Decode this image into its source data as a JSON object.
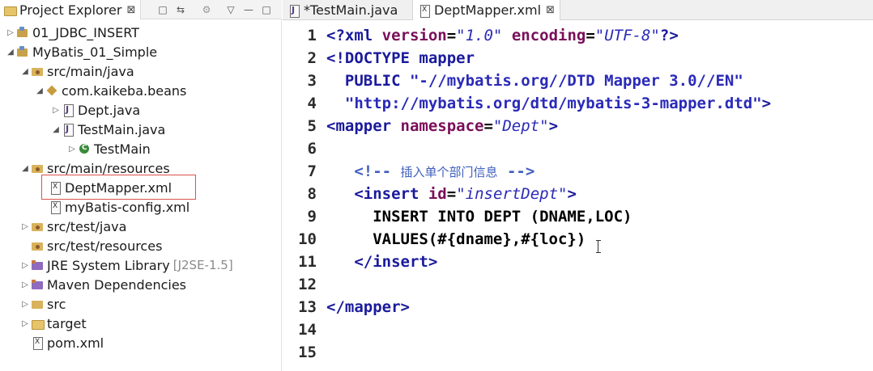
{
  "explorer": {
    "title": "Project Explorer",
    "close": "⊠",
    "toolbar": {
      "collapse_icon": "□",
      "link_icon": "⇆",
      "menu_icon": "▽",
      "minimize_icon": "—",
      "maximize_icon": "□"
    },
    "items": [
      {
        "label": "01_JDBC_INSERT",
        "icon": "project-icon"
      },
      {
        "label": "MyBatis_01_Simple",
        "icon": "project-icon"
      },
      {
        "label": "src/main/java",
        "icon": "source-folder-icon"
      },
      {
        "label": "com.kaikeba.beans",
        "icon": "package-icon"
      },
      {
        "label": "Dept.java",
        "icon": "java-file-icon"
      },
      {
        "label": "TestMain.java",
        "icon": "java-file-icon"
      },
      {
        "label": "TestMain",
        "icon": "class-icon"
      },
      {
        "label": "src/main/resources",
        "icon": "source-folder-icon"
      },
      {
        "label": "DeptMapper.xml",
        "icon": "xml-file-icon"
      },
      {
        "label": "myBatis-config.xml",
        "icon": "xml-file-icon"
      },
      {
        "label": "src/test/java",
        "icon": "source-folder-icon"
      },
      {
        "label": "src/test/resources",
        "icon": "source-folder-icon"
      },
      {
        "label": "JRE System Library",
        "suffix": "[J2SE-1.5]",
        "icon": "library-icon"
      },
      {
        "label": "Maven Dependencies",
        "icon": "library-icon"
      },
      {
        "label": "src",
        "icon": "folder-icon"
      },
      {
        "label": "target",
        "icon": "folder-icon"
      },
      {
        "label": "pom.xml",
        "icon": "xml-file-icon"
      }
    ]
  },
  "editor": {
    "tabs": [
      {
        "label": "*TestMain.java",
        "icon": "java-file-icon",
        "active": false
      },
      {
        "label": "DeptMapper.xml",
        "icon": "xml-file-icon",
        "active": true,
        "close": "⊠"
      }
    ],
    "lines": {
      "l1": {
        "num": "1",
        "p1": "<?xml ",
        "p2": "version",
        "p3": "=",
        "p4": "\"1.0\"",
        "p5": " ",
        "p6": "encoding",
        "p7": "=",
        "p8": "\"UTF-8\"",
        "p9": "?>"
      },
      "l2": {
        "num": "2",
        "p1": "<!DOCTYPE mapper"
      },
      "l3": {
        "num": "3",
        "p1": "  PUBLIC ",
        "p2": "\"-//mybatis.org//DTD Mapper 3.0//EN\""
      },
      "l4": {
        "num": "4",
        "p1": "  \"http://mybatis.org/dtd/mybatis-3-mapper.dtd\"",
        "p2": ">"
      },
      "l5": {
        "num": "5",
        "p1": "<mapper ",
        "p2": "namespace",
        "p3": "=",
        "p4": "\"Dept\"",
        "p5": ">"
      },
      "l6": {
        "num": "6"
      },
      "l7": {
        "num": "7",
        "p1": "   <!-- ",
        "p2": "插入单个部门信息",
        "p3": " -->"
      },
      "l8": {
        "num": "8",
        "p1": "   <insert ",
        "p2": "id",
        "p3": "=",
        "p4": "\"insertDept\"",
        "p5": ">"
      },
      "l9": {
        "num": "9",
        "p1": "     INSERT INTO DEPT (DNAME,LOC)"
      },
      "l10": {
        "num": "10",
        "p1": "     VALUES(#{dname},#{loc})"
      },
      "l11": {
        "num": "11",
        "p1": "   </insert>"
      },
      "l12": {
        "num": "12"
      },
      "l13": {
        "num": "13",
        "p1": "</mapper>"
      },
      "l14": {
        "num": "14"
      },
      "l15": {
        "num": "15"
      }
    }
  }
}
